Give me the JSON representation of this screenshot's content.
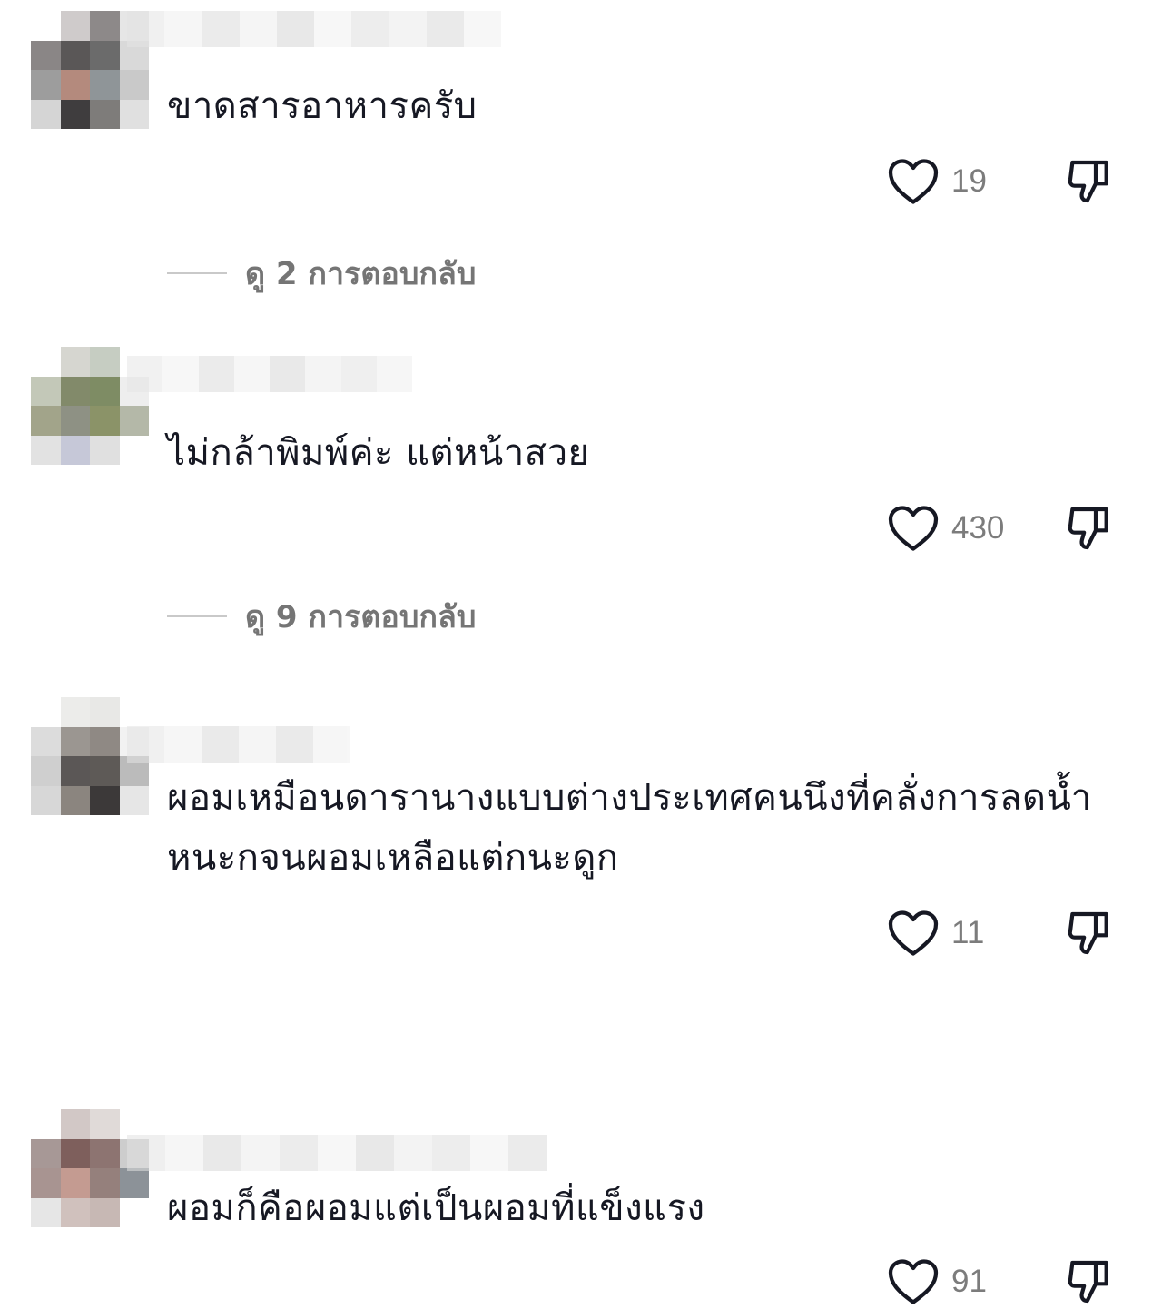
{
  "comments": [
    {
      "text": "ขาดสารอาหารครับ",
      "likes": "19",
      "replies_label": "ดู 2 การตอบกลับ",
      "avatar_colors": [
        "#ffffff",
        "#cfcbcb",
        "#8d8989",
        "#e6e6e6",
        "#8a8686",
        "#5a5757",
        "#6b6b6b",
        "#d9d9d9",
        "#9d9d9d",
        "#b48a7d",
        "#8f9598",
        "#c9c9c9",
        "#d5d5d5",
        "#3f3d3e",
        "#7e7c7a",
        "#e0e0e0"
      ]
    },
    {
      "text": "ไม่กล้าพิมพ์ค่ะ แต่หน้าสวย",
      "likes": "430",
      "replies_label": "ดู 9 การตอบกลับ",
      "avatar_colors": [
        "#ffffff",
        "#d6d6d0",
        "#c6cdc2",
        "#ffffff",
        "#c3c8b8",
        "#828a6a",
        "#7e8c64",
        "#eeeeee",
        "#a2a48a",
        "#8e9184",
        "#8b9368",
        "#b4b8a8",
        "#e2e2e2",
        "#c6c8d8",
        "#e0e0e0",
        "#ffffff"
      ]
    },
    {
      "text": "ผอมเหมือนดารานางแบบต่างประเทศคนนึงที่คลั่งการลดน้ำหนะกจนผอมเหลือแต่กนะดูก",
      "likes": "11",
      "replies_label": "",
      "avatar_colors": [
        "#ffffff",
        "#ececea",
        "#e8e8e6",
        "#ffffff",
        "#dcdcdc",
        "#9b9691",
        "#8f8984",
        "#f2f2f2",
        "#cfcfcf",
        "#5b5756",
        "#5e5a57",
        "#bbbbbb",
        "#d7d7d7",
        "#8b857f",
        "#3c3939",
        "#e6e6e6"
      ]
    },
    {
      "text": "ผอมก็คือผอมแต่เป็นผอมที่แข็งแรง",
      "likes": "91",
      "replies_label": "",
      "avatar_colors": [
        "#ffffff",
        "#d2c8c6",
        "#e0dad8",
        "#ffffff",
        "#a79896",
        "#7e5f5c",
        "#8d7471",
        "#cdcdcd",
        "#a89491",
        "#c49b91",
        "#95807c",
        "#8c9298",
        "#e6e6e6",
        "#d0c1bd",
        "#c7b8b4",
        "#ffffff"
      ]
    }
  ],
  "colors": {
    "text": "#161823",
    "muted": "#757575",
    "icon": "#161823",
    "divider": "#c9c9c9"
  },
  "icons": {
    "like": "heart-outline-icon",
    "dislike": "thumbs-down-outline-icon"
  }
}
